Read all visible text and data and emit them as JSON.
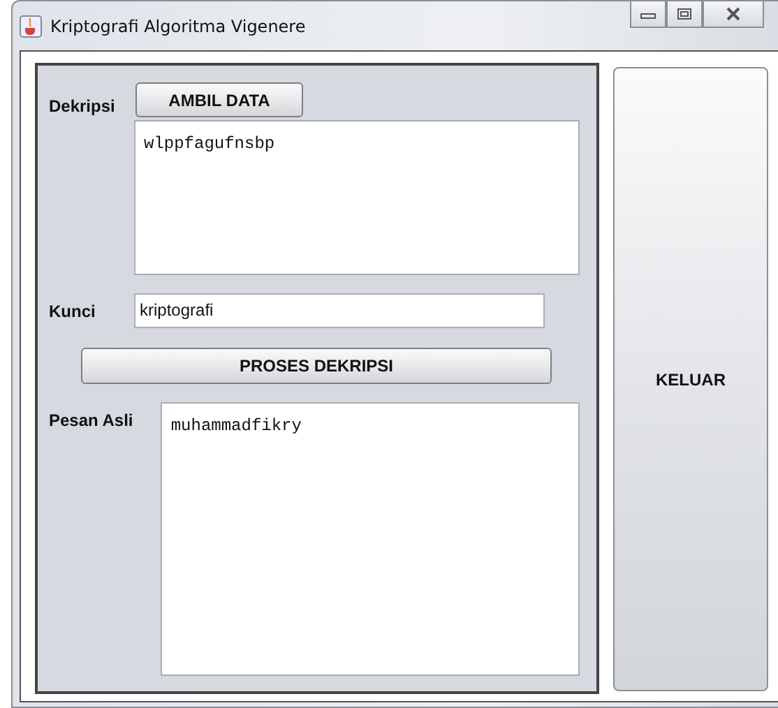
{
  "window": {
    "title": "Kriptografi Algoritma Vigenere"
  },
  "form": {
    "dekripsi_label": "Dekripsi",
    "ambil_button": "AMBIL DATA",
    "ciphertext": "wlppfagufnsbp",
    "kunci_label": "Kunci",
    "kunci_value": "kriptografi",
    "proses_button": "PROSES DEKRIPSI",
    "pesan_label": "Pesan Asli",
    "plaintext": "muhammadfikry"
  },
  "keluar_button": "KELUAR"
}
